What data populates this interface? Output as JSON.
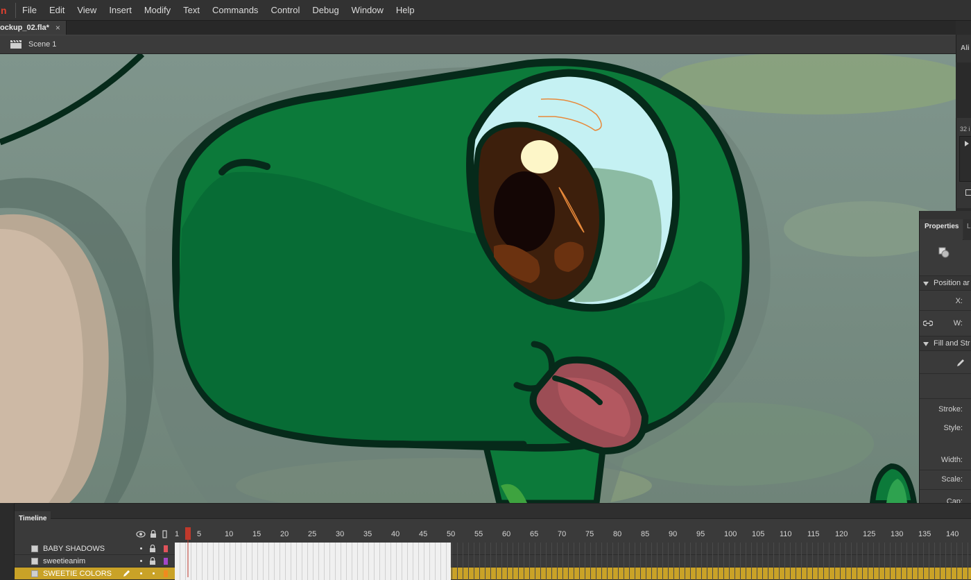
{
  "menu": {
    "logo": "n",
    "items": [
      "File",
      "Edit",
      "View",
      "Insert",
      "Modify",
      "Text",
      "Commands",
      "Control",
      "Debug",
      "Window",
      "Help"
    ]
  },
  "document": {
    "tab_name": "ockup_02.fla*",
    "close_glyph": "×"
  },
  "editbar": {
    "scene": "Scene 1"
  },
  "panels": {
    "align_tab": "Ali",
    "library_count": "32 i",
    "properties_tab": "Properties",
    "library_tab": "L",
    "sections": [
      "Position ar",
      "Fill and Str"
    ],
    "labels": {
      "x": "X:",
      "w": "W:",
      "stroke": "Stroke:",
      "style": "Style:",
      "width": "Width:",
      "scale": "Scale:",
      "cap": "Cap:"
    }
  },
  "timeline": {
    "tab": "Timeline",
    "ruler": [
      "1",
      "5",
      "10",
      "15",
      "20",
      "25",
      "30",
      "35",
      "40",
      "45",
      "50",
      "55",
      "60",
      "65",
      "70",
      "75",
      "80",
      "85",
      "90",
      "95",
      "100",
      "105",
      "110",
      "115",
      "120",
      "125",
      "130",
      "135",
      "140"
    ],
    "current_frame": 5,
    "layers": [
      {
        "name": "BABY SHADOWS",
        "color": "#e0535b",
        "active": false
      },
      {
        "name": "sweetieanim",
        "color": "#a247c7",
        "active": false
      },
      {
        "name": "SWEETIE COLORS",
        "color": "#f08a1e",
        "active": true
      }
    ]
  },
  "colors": {
    "accent": "#c9a227",
    "playhead": "#c0392b",
    "creature_green": "#0c7a3a",
    "outline": "#062a1a"
  }
}
